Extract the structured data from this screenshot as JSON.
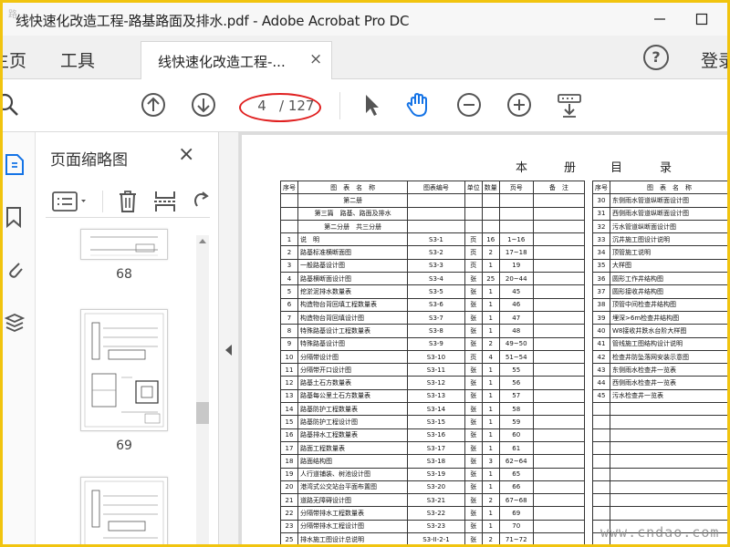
{
  "window": {
    "title": "线快速化改造工程-路基路面及排水.pdf - Adobe Acrobat Pro DC",
    "corner_mark": "路..."
  },
  "tabs": {
    "home": "主页",
    "tools": "工具",
    "document": "线快速化改造工程-...",
    "document_close": "×",
    "help": "?",
    "login": "登录"
  },
  "toolbar": {
    "current_page": "4",
    "total_pages": "/ 127"
  },
  "thumbnails": {
    "title": "页面缩略图",
    "close": "×",
    "pages": [
      "68",
      "69"
    ]
  },
  "document": {
    "heading": [
      "本",
      "册",
      "目",
      "录"
    ],
    "left_headers": [
      "序号",
      "图　表　名　称",
      "图表编号",
      "单位",
      "数量",
      "页号",
      "备　注"
    ],
    "left_rows": [
      [
        "",
        "第二册",
        "",
        "",
        "",
        "",
        ""
      ],
      [
        "",
        "第三篇　路基、路面及排水",
        "",
        "",
        "",
        "",
        ""
      ],
      [
        "",
        "第二分册　共三分册",
        "",
        "",
        "",
        "",
        ""
      ],
      [
        "1",
        "说　明",
        "S3-1",
        "页",
        "16",
        "1~16",
        ""
      ],
      [
        "2",
        "路基标准横断面图",
        "S3-2",
        "页",
        "2",
        "17~18",
        ""
      ],
      [
        "3",
        "一般路基设计图",
        "S3-3",
        "页",
        "1",
        "19",
        ""
      ],
      [
        "4",
        "路基横断面设计图",
        "S3-4",
        "张",
        "25",
        "20~44",
        ""
      ],
      [
        "5",
        "挖淤泥排水数量表",
        "S3-5",
        "张",
        "1",
        "45",
        ""
      ],
      [
        "6",
        "构造物台背回填工程数量表",
        "S3-6",
        "张",
        "1",
        "46",
        ""
      ],
      [
        "7",
        "构造物台背回填设计图",
        "S3-7",
        "张",
        "1",
        "47",
        ""
      ],
      [
        "8",
        "特殊路基设计工程数量表",
        "S3-8",
        "张",
        "1",
        "48",
        ""
      ],
      [
        "9",
        "特殊路基设计图",
        "S3-9",
        "张",
        "2",
        "49~50",
        ""
      ],
      [
        "10",
        "分隔带设计图",
        "S3-10",
        "页",
        "4",
        "51~54",
        ""
      ],
      [
        "11",
        "分隔带开口设计图",
        "S3-11",
        "张",
        "1",
        "55",
        ""
      ],
      [
        "12",
        "路基土石方数量表",
        "S3-12",
        "张",
        "1",
        "56",
        ""
      ],
      [
        "13",
        "路基每公里土石方数量表",
        "S3-13",
        "张",
        "1",
        "57",
        ""
      ],
      [
        "14",
        "路基防护工程数量表",
        "S3-14",
        "张",
        "1",
        "58",
        ""
      ],
      [
        "15",
        "路基防护工程设计图",
        "S3-15",
        "张",
        "1",
        "59",
        ""
      ],
      [
        "16",
        "路基排水工程数量表",
        "S3-16",
        "张",
        "1",
        "60",
        ""
      ],
      [
        "17",
        "路面工程数量表",
        "S3-17",
        "张",
        "1",
        "61",
        ""
      ],
      [
        "18",
        "路面结构图",
        "S3-18",
        "张",
        "3",
        "62~64",
        ""
      ],
      [
        "19",
        "人行道铺装、树池设计图",
        "S3-19",
        "张",
        "1",
        "65",
        ""
      ],
      [
        "20",
        "港湾式公交站台平面布置图",
        "S3-20",
        "张",
        "1",
        "66",
        ""
      ],
      [
        "21",
        "道路无障碍设计图",
        "S3-21",
        "张",
        "2",
        "67~68",
        ""
      ],
      [
        "22",
        "分隔带排水工程数量表",
        "S3-22",
        "张",
        "1",
        "69",
        ""
      ],
      [
        "23",
        "分隔带排水工程设计图",
        "S3-23",
        "张",
        "1",
        "70",
        ""
      ],
      [
        "25",
        "排水施工图设计总说明",
        "S3-II-2-1",
        "张",
        "2",
        "71~72",
        ""
      ]
    ],
    "right_header": "图　表　名　称",
    "right_rows": [
      [
        "30",
        "东侧雨水管道纵断面设计图"
      ],
      [
        "31",
        "西侧雨水管道纵断面设计图"
      ],
      [
        "32",
        "污水管道纵断面设计图"
      ],
      [
        "33",
        "沉井施工图设计说明"
      ],
      [
        "34",
        "顶管施工说明"
      ],
      [
        "35",
        "大样图"
      ],
      [
        "36",
        "圆形工作井结构图"
      ],
      [
        "37",
        "圆形接收井结构图"
      ],
      [
        "38",
        "顶管中间检查井结构图"
      ],
      [
        "39",
        "埋深>6m检查井结构图"
      ],
      [
        "40",
        "W8接收井跌水台阶大样图"
      ],
      [
        "41",
        "管线施工图结构设计说明"
      ],
      [
        "42",
        "检查井防坠落网安装示意图"
      ],
      [
        "43",
        "东侧雨水检查井一览表"
      ],
      [
        "44",
        "西侧雨水检查井一览表"
      ],
      [
        "45",
        "污水检查井一览表"
      ],
      [
        "",
        ""
      ],
      [
        "",
        ""
      ],
      [
        "",
        ""
      ],
      [
        "",
        ""
      ],
      [
        "",
        ""
      ],
      [
        "",
        ""
      ],
      [
        "",
        ""
      ],
      [
        "",
        ""
      ],
      [
        "",
        ""
      ],
      [
        "",
        ""
      ],
      [
        "",
        ""
      ]
    ]
  },
  "watermark": "www.cndao.com",
  "colors": {
    "frame": "#f1c40f",
    "annotation": "#e02020",
    "hand_tool": "#1473e6"
  }
}
